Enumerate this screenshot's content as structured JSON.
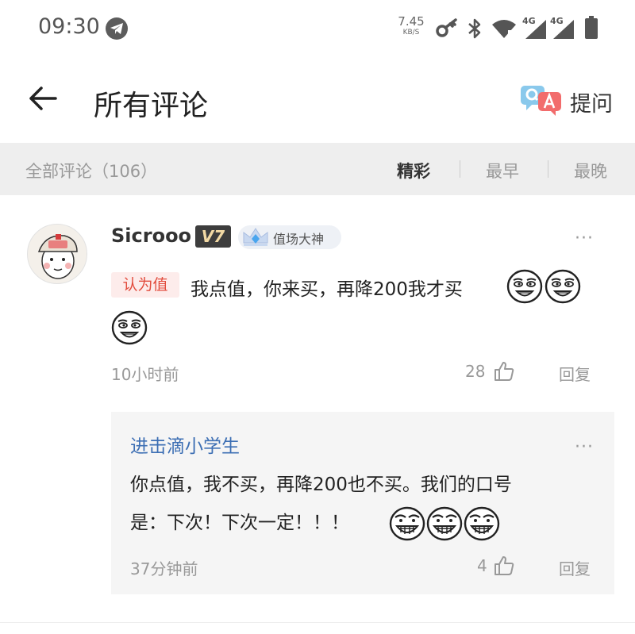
{
  "status_bar": {
    "time": "09:30",
    "speed_value": "7.45",
    "speed_unit": "KB/S",
    "network_1": "4G",
    "network_2": "4G"
  },
  "header": {
    "title": "所有评论",
    "ask_label": "提问"
  },
  "filter": {
    "all_comments": "全部评论（106）",
    "sort_options": [
      "精彩",
      "最早",
      "最晚"
    ],
    "active_sort": "精彩"
  },
  "comment": {
    "username": "Sicrooo",
    "level": "V7",
    "honor": "值场大神",
    "stance": "认为值",
    "text": "我点值，你来买，再降200我才买",
    "emojis": [
      "grin-face",
      "grin-face",
      "grin-face"
    ],
    "time": "10小时前",
    "likes": "28",
    "reply_label": "回复",
    "more": "···"
  },
  "reply": {
    "username": "进击滴小学生",
    "line1": "你点值，我不买，再降200也不买。我们的口号",
    "line2": "是：下次！下次一定！！！",
    "emojis": [
      "teeth-face",
      "teeth-face",
      "teeth-face"
    ],
    "time": "37分钟前",
    "likes": "4",
    "reply_label": "回复",
    "more": "···"
  },
  "colors": {
    "stance_red": "#e24c3d",
    "reply_user_blue": "#3d6fb4",
    "filter_bg": "#eeeeee",
    "reply_bg": "#f5f5f5"
  }
}
